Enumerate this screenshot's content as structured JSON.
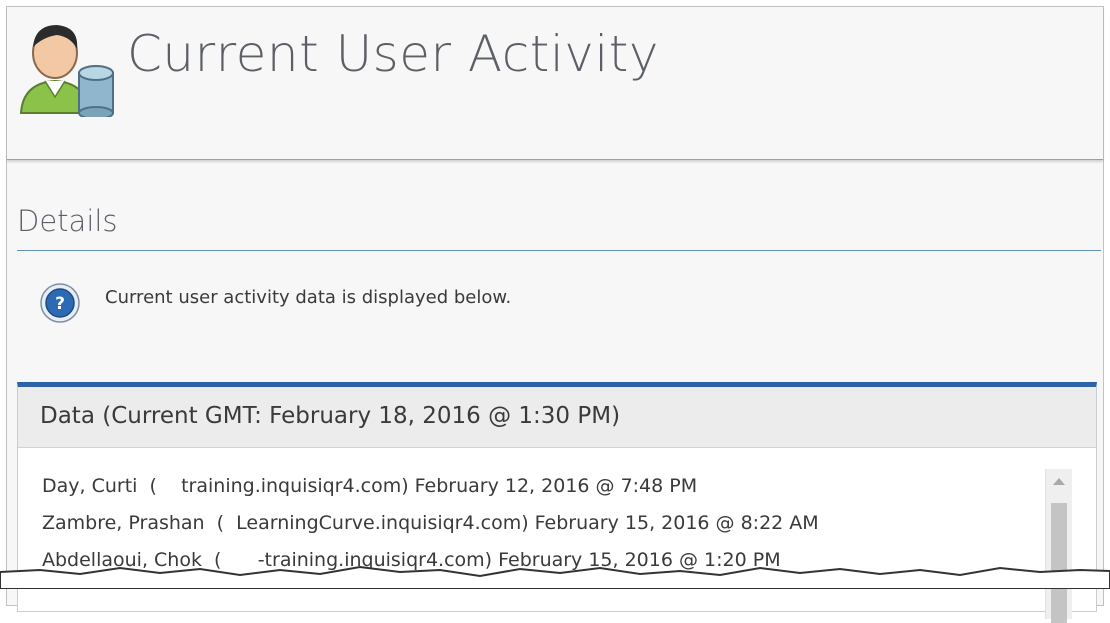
{
  "header": {
    "title": "Current User Activity",
    "icon": "user-database-icon"
  },
  "details": {
    "section_title": "Details",
    "info_icon": "help-question-icon",
    "info_text": "Current user activity data is displayed below."
  },
  "data_panel": {
    "title": "Data (Current GMT: February 18, 2016 @ 1:30 PM)",
    "rows": [
      "Day, Curti  (    training.inquisiqr4.com) February 12, 2016 @ 7:48 PM",
      "Zambre, Prashan  (  LearningCurve.inquisiqr4.com) February 15, 2016 @ 8:22 AM",
      "Abdellaoui, Chok  (      -training.inquisiqr4.com) February 15, 2016 @ 1:20 PM"
    ]
  },
  "colors": {
    "accent_blue": "#2f63a8",
    "rule_blue": "#5f8fb3",
    "title_gray": "#5c6066"
  }
}
